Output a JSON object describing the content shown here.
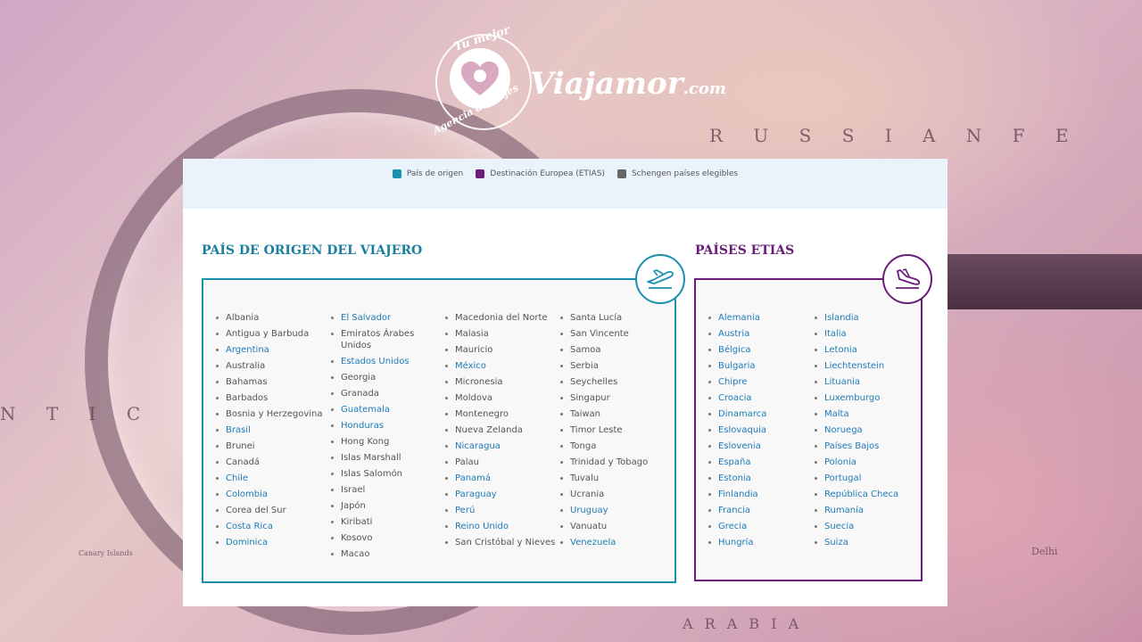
{
  "logo": {
    "arc_top": "Tu mejor",
    "arc_left": "Agencia de viajes",
    "brand": "Viajamor",
    "domain": ".com"
  },
  "legend": [
    {
      "label": "País de origen",
      "color": "#1a8fae"
    },
    {
      "label": "Destinación Europea (ETIAS)",
      "color": "#6a1d7a"
    },
    {
      "label": "Schengen países elegibles",
      "color": "#666666"
    }
  ],
  "origin": {
    "title": "PAÍS DE ORIGEN DEL VIAJERO",
    "icon": "plane-takeoff-icon",
    "columns": [
      [
        {
          "name": "Albania",
          "hl": false
        },
        {
          "name": "Antigua y Barbuda",
          "hl": false
        },
        {
          "name": "Argentina",
          "hl": true
        },
        {
          "name": "Australia",
          "hl": false
        },
        {
          "name": "Bahamas",
          "hl": false
        },
        {
          "name": "Barbados",
          "hl": false
        },
        {
          "name": "Bosnia y Herzegovina",
          "hl": false
        },
        {
          "name": "Brasil",
          "hl": true
        },
        {
          "name": "Brunei",
          "hl": false
        },
        {
          "name": "Canadá",
          "hl": false
        },
        {
          "name": "Chile",
          "hl": true
        },
        {
          "name": "Colombia",
          "hl": true
        },
        {
          "name": "Corea del Sur",
          "hl": false
        },
        {
          "name": "Costa Rica",
          "hl": true
        },
        {
          "name": "Dominica",
          "hl": true
        }
      ],
      [
        {
          "name": "El Salvador",
          "hl": true
        },
        {
          "name": "Emiratos Árabes Unidos",
          "hl": false
        },
        {
          "name": "Estados Unidos",
          "hl": true
        },
        {
          "name": "Georgia",
          "hl": false
        },
        {
          "name": "Granada",
          "hl": false
        },
        {
          "name": "Guatemala",
          "hl": true
        },
        {
          "name": "Honduras",
          "hl": true
        },
        {
          "name": "Hong Kong",
          "hl": false
        },
        {
          "name": "Islas Marshall",
          "hl": false
        },
        {
          "name": "Islas Salomón",
          "hl": false
        },
        {
          "name": "Israel",
          "hl": false
        },
        {
          "name": "Japón",
          "hl": false
        },
        {
          "name": "Kiribati",
          "hl": false
        },
        {
          "name": "Kosovo",
          "hl": false
        },
        {
          "name": "Macao",
          "hl": false
        }
      ],
      [
        {
          "name": "Macedonia del Norte",
          "hl": false
        },
        {
          "name": "Malasia",
          "hl": false
        },
        {
          "name": "Mauricio",
          "hl": false
        },
        {
          "name": "México",
          "hl": true
        },
        {
          "name": "Micronesia",
          "hl": false
        },
        {
          "name": "Moldova",
          "hl": false
        },
        {
          "name": "Montenegro",
          "hl": false
        },
        {
          "name": "Nueva Zelanda",
          "hl": false
        },
        {
          "name": "Nicaragua",
          "hl": true
        },
        {
          "name": "Palau",
          "hl": false
        },
        {
          "name": "Panamá",
          "hl": true
        },
        {
          "name": "Paraguay",
          "hl": true
        },
        {
          "name": "Perú",
          "hl": true
        },
        {
          "name": "Reino Unido",
          "hl": true
        },
        {
          "name": "San Cristóbal y Nieves",
          "hl": false
        }
      ],
      [
        {
          "name": "Santa Lucía",
          "hl": false
        },
        {
          "name": "San Vincente",
          "hl": false
        },
        {
          "name": "Samoa",
          "hl": false
        },
        {
          "name": "Serbia",
          "hl": false
        },
        {
          "name": "Seychelles",
          "hl": false
        },
        {
          "name": "Singapur",
          "hl": false
        },
        {
          "name": "Taiwan",
          "hl": false
        },
        {
          "name": "Timor Leste",
          "hl": false
        },
        {
          "name": "Tonga",
          "hl": false
        },
        {
          "name": "Trinidad y Tobago",
          "hl": false
        },
        {
          "name": "Tuvalu",
          "hl": false
        },
        {
          "name": "Ucrania",
          "hl": false
        },
        {
          "name": "Uruguay",
          "hl": true
        },
        {
          "name": "Vanuatu",
          "hl": false
        },
        {
          "name": "Venezuela",
          "hl": true
        }
      ]
    ]
  },
  "etias": {
    "title": "PAÍSES ETIAS",
    "icon": "plane-landing-icon",
    "columns": [
      [
        "Alemania",
        "Austria",
        "Bélgica",
        "Bulgaria",
        "Chipre",
        "Croacia",
        "Dinamarca",
        "Eslovaquia",
        "Eslovenia",
        "España",
        "Estonia",
        "Finlandia",
        "Francia",
        "Grecia",
        "Hungría"
      ],
      [
        "Islandia",
        "Italia",
        "Letonia",
        "Liechtenstein",
        "Lituania",
        "Luxemburgo",
        "Malta",
        "Noruega",
        "Países Bajos",
        "Polonia",
        "Portugal",
        "República Checa",
        "Rumanía",
        "Suecia",
        "Suiza"
      ]
    ]
  },
  "background_labels": [
    "R U S S I A N   F E",
    "N T I C",
    "A R A B I A",
    "Canary Islands",
    "Delhi"
  ]
}
